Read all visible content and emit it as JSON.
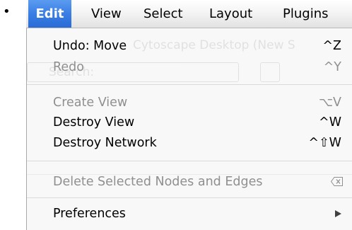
{
  "bullet": "•",
  "menubar": {
    "items": [
      {
        "label": "Edit",
        "active": true
      },
      {
        "label": "View"
      },
      {
        "label": "Select"
      },
      {
        "label": "Layout"
      },
      {
        "label": "Plugins"
      }
    ]
  },
  "background_window": {
    "title_fragment": "Cytoscape Desktop (New S",
    "search_placeholder": "Search:"
  },
  "edit_menu": {
    "items": [
      {
        "label": "Undo: Move",
        "shortcut": "^Z",
        "enabled": true
      },
      {
        "label": "Redo",
        "shortcut": "^Y",
        "enabled": false
      },
      {
        "label": "Create View",
        "shortcut": "⌥V",
        "enabled": false
      },
      {
        "label": "Destroy View",
        "shortcut": "^W",
        "enabled": true
      },
      {
        "label": "Destroy Network",
        "shortcut": "^⇧W",
        "enabled": true
      },
      {
        "label": "Delete Selected Nodes and Edges",
        "shortcut_icon": "delete-key-icon",
        "enabled": false
      },
      {
        "label": "Preferences",
        "submenu_icon": "submenu-arrow-icon",
        "enabled": true
      }
    ]
  },
  "colors": {
    "highlight": "#3a7ee4",
    "enabled_text": "#000000",
    "disabled_text": "#8f8f8f",
    "separator": "#dadada"
  }
}
